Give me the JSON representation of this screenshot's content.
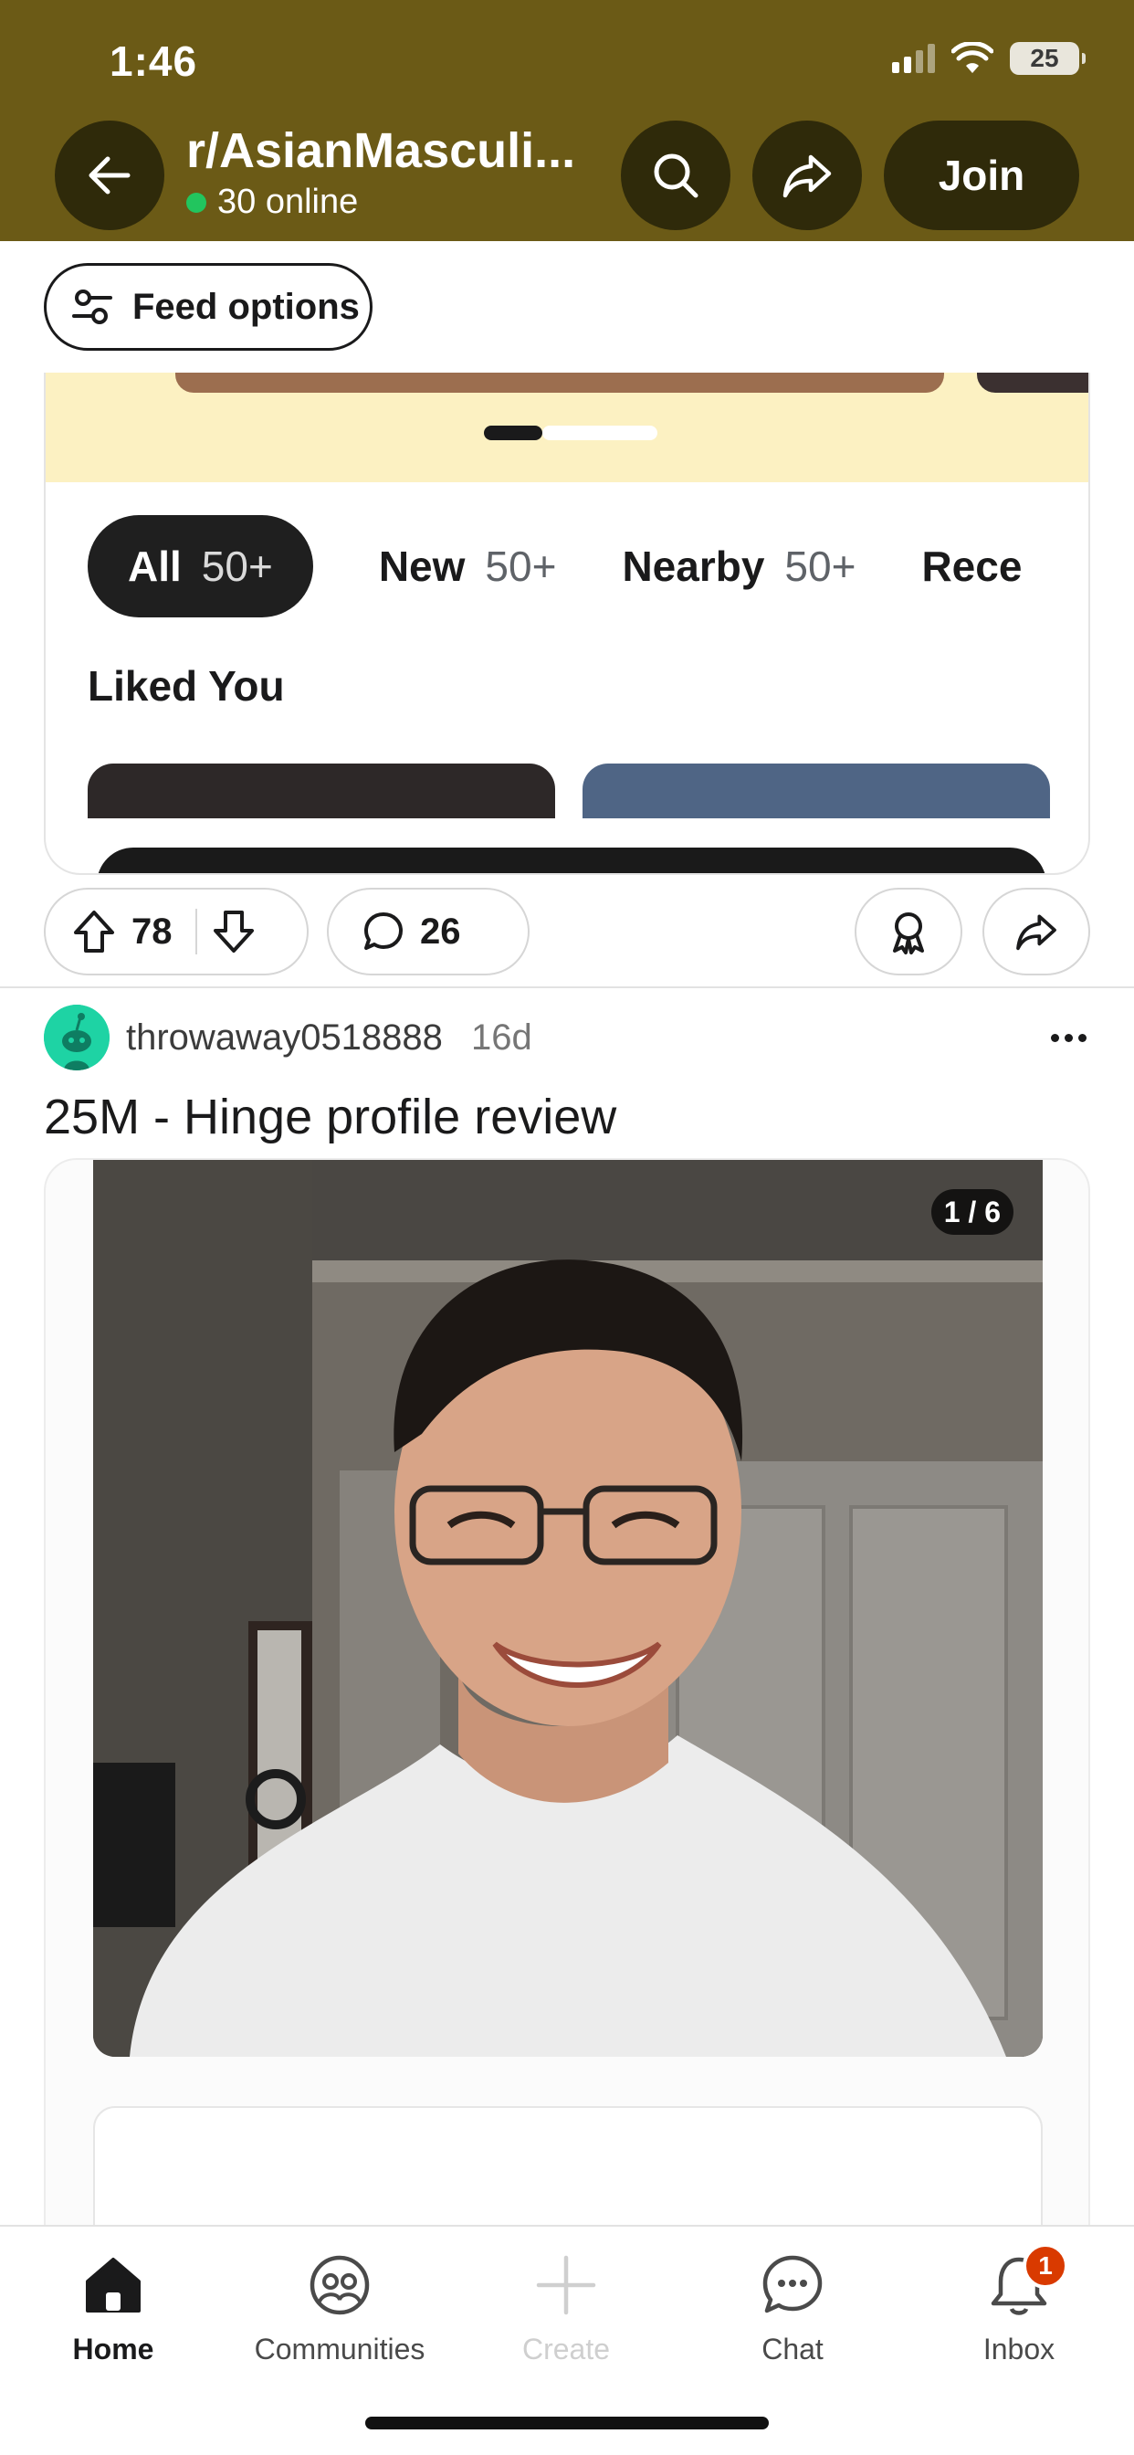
{
  "status_bar": {
    "time": "1:46",
    "battery": "25"
  },
  "header": {
    "community_name": "r/AsianMasculi...",
    "online_count": "30 online",
    "join_label": "Join",
    "accent_color": "#6b5a16"
  },
  "feed_options": {
    "label": "Feed options"
  },
  "embedded_preview": {
    "filters": [
      {
        "label": "All",
        "count": "50+",
        "active": true
      },
      {
        "label": "New",
        "count": "50+",
        "active": false
      },
      {
        "label": "Nearby",
        "count": "50+",
        "active": false
      },
      {
        "label": "Rece",
        "count": "",
        "active": false
      }
    ],
    "section_title": "Liked You"
  },
  "previous_post_actions": {
    "upvotes": "78",
    "comments": "26"
  },
  "post": {
    "author": "throwaway0518888",
    "age": "16d",
    "title": "25M - Hinge profile review",
    "image_counter": "1 / 6"
  },
  "bottom_nav": {
    "items": [
      {
        "label": "Home",
        "icon": "home-icon"
      },
      {
        "label": "Communities",
        "icon": "communities-icon"
      },
      {
        "label": "Create",
        "icon": "plus-icon"
      },
      {
        "label": "Chat",
        "icon": "chat-icon"
      },
      {
        "label": "Inbox",
        "icon": "bell-icon"
      }
    ],
    "inbox_badge": "1"
  }
}
